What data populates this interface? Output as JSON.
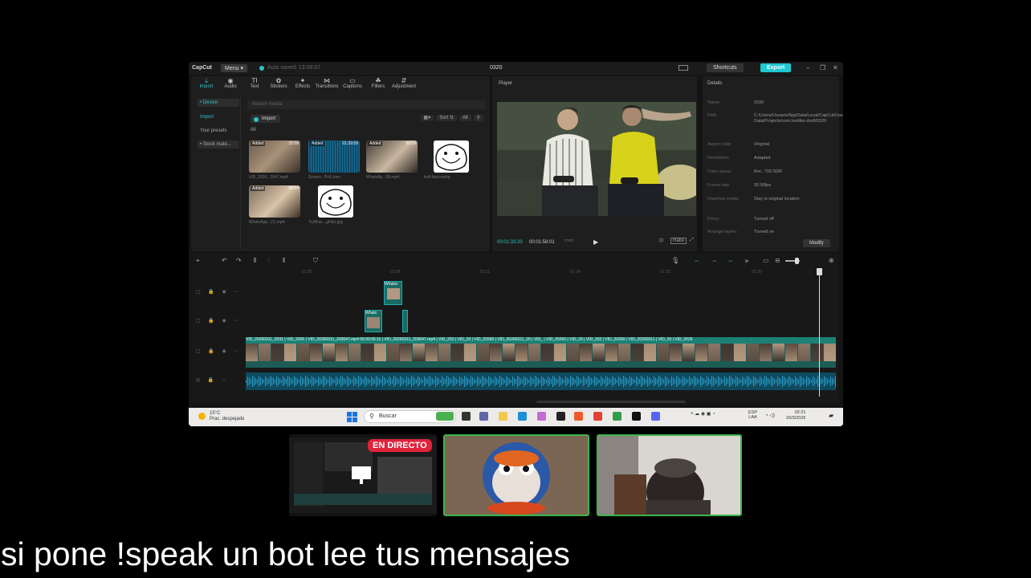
{
  "app": {
    "logo": "CapCut",
    "menu": "Menu ▾",
    "save_status": "Auto saved: 13:08:07",
    "project_title": "0320",
    "shortcuts": "Shortcuts",
    "export": "Export",
    "win_min": "–",
    "win_max": "❐",
    "win_close": "✕"
  },
  "toolbar": [
    {
      "icon": "⤓",
      "label": "Import",
      "active": true
    },
    {
      "icon": "◉",
      "label": "Audio"
    },
    {
      "icon": "TI",
      "label": "Text"
    },
    {
      "icon": "✿",
      "label": "Stickers"
    },
    {
      "icon": "✦",
      "label": "Effects"
    },
    {
      "icon": "⋈",
      "label": "Transitions"
    },
    {
      "icon": "▭",
      "label": "Captions"
    },
    {
      "icon": "☘",
      "label": "Filters"
    },
    {
      "icon": "⇵",
      "label": "Adjustment"
    }
  ],
  "leftnav": {
    "device": "• Device",
    "import": "Import",
    "presets": "Your presets",
    "stock": "• Stock mate..."
  },
  "media": {
    "search_placeholder": "Search media",
    "import_label": "Import",
    "sort": "Sort ⇅",
    "all_filter": "All",
    "filter_icon": "⚲",
    "all_label": "All",
    "items": [
      {
        "badge": "Added",
        "duration": "15:58",
        "caption": "VID_2026...3047.mp4",
        "kind": "video-bedroom"
      },
      {
        "badge": "Added",
        "duration": "01:29:59",
        "caption": "Screen...PxS.mov",
        "kind": "audio-wave"
      },
      {
        "badge": "Added",
        "duration": "00:09",
        "caption": "WhatsAp...59.mp4",
        "kind": "video-face"
      },
      {
        "badge": "",
        "duration": "",
        "caption": "troll-face.webp",
        "kind": "troll"
      },
      {
        "badge": "Added",
        "duration": "00:04",
        "caption": "WhatsApp...(1).mp4",
        "kind": "video-face2"
      },
      {
        "badge": "",
        "duration": "",
        "caption": "TrollFac...gFile).jpg",
        "kind": "troll"
      }
    ]
  },
  "player": {
    "title": "Player",
    "current_time": "00:01:33:20",
    "total_time": "00:01:58:01",
    "play": "▶",
    "ratio": "Ratio"
  },
  "details": {
    "title": "Details",
    "rows": [
      {
        "k": "Name:",
        "v": "0320"
      },
      {
        "k": "Path:",
        "v": "C:/Users/Usuario/AppData/Local/CapCut/User Data/Projects/com.lveditor.draft/0320"
      },
      {
        "k": "Aspect ratio:",
        "v": "Original"
      },
      {
        "k": "Resolution:",
        "v": "Adapted"
      },
      {
        "k": "Color space:",
        "v": "Rec. 709 SDR"
      },
      {
        "k": "Frame rate:",
        "v": "30.00fps"
      },
      {
        "k": "Imported media:",
        "v": "Stay in original location"
      },
      {
        "k": "Proxy:",
        "v": "Turned off"
      },
      {
        "k": "Arrange layers:",
        "v": "Turned on"
      }
    ],
    "modify": "Modify"
  },
  "timeline": {
    "ruler": [
      "01:05",
      "01:08",
      "01:11",
      "01:14",
      "01:25",
      "01:30"
    ],
    "overlay_clip_1": "Whatsv",
    "overlay_clip_2": "Whats",
    "main_clip_labels": "VID_20260311_2031 | VID_2026 | VID_20260311_203047.mp4  00:00:05:11 | VID_20260311_203047.mp4 | VID_202 | VID_20 | VID_20260 | VID_20260311_20 | VID_ | VID_20260 | VID_20 | VID_202 | VID_20260 | VID_20260311 | VID_20 | VID_2026"
  },
  "taskbar": {
    "temp": "15°C",
    "weather": "Prac. despejado",
    "search": "Buscar",
    "lang1": "ESP",
    "lang2": "LAA",
    "time": "02:21",
    "date": "20/3/2026"
  },
  "stream": {
    "live_badge": "EN DIRECTO"
  },
  "subtitle": "si pone !speak un bot lee tus mensajes",
  "colors": {
    "accent": "#2fc3c5",
    "live": "#e0233b",
    "cam_border": "#3db34a"
  }
}
